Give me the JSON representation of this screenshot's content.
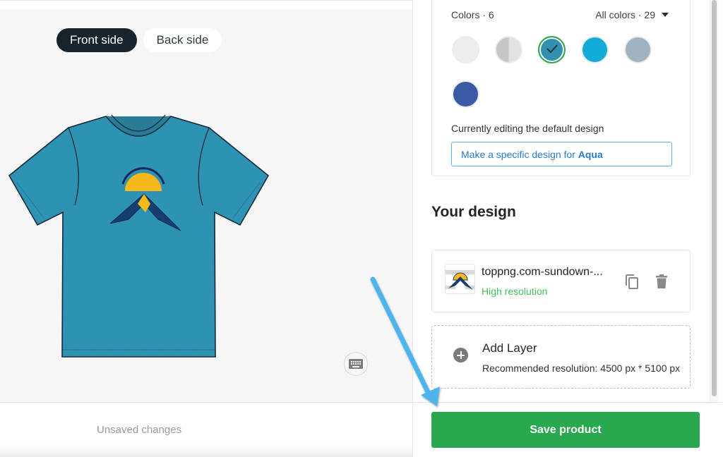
{
  "preview": {
    "sides": [
      {
        "label": "Front side",
        "active": true
      },
      {
        "label": "Back side",
        "active": false
      }
    ],
    "product_color": "#2e93b3",
    "keyboard_icon": "keyboard-icon"
  },
  "footer": {
    "status": "Unsaved changes",
    "save_label": "Save product"
  },
  "colors": {
    "count_label": "Colors · 6",
    "all_colors_label": "All colors · 29",
    "swatches": [
      {
        "name": "White",
        "color": "#ededed",
        "selected": false
      },
      {
        "name": "Heather Grey",
        "color": "#cfcfcf",
        "selected": false
      },
      {
        "name": "Aqua",
        "color": "#3290ae",
        "selected": true
      },
      {
        "name": "Turquoise",
        "color": "#13acd6",
        "selected": false
      },
      {
        "name": "Heather Blue",
        "color": "#a2b3c0",
        "selected": false
      },
      {
        "name": "Royal Blue",
        "color": "#3a5aa6",
        "selected": false
      }
    ],
    "editing_text": "Currently editing the default design",
    "specific_prefix": "Make a specific design for ",
    "specific_color": "Aqua"
  },
  "design": {
    "heading": "Your design",
    "layer": {
      "name": "toppng.com-sundown-...",
      "resolution": "High resolution",
      "duplicate_icon": "copy-icon",
      "delete_icon": "trash-icon"
    },
    "add_layer": {
      "title": "Add Layer",
      "subtitle": "Recommended resolution: 4500 px * 5100 px"
    }
  },
  "annotation": {
    "arrow_color": "#4eb4ec"
  }
}
